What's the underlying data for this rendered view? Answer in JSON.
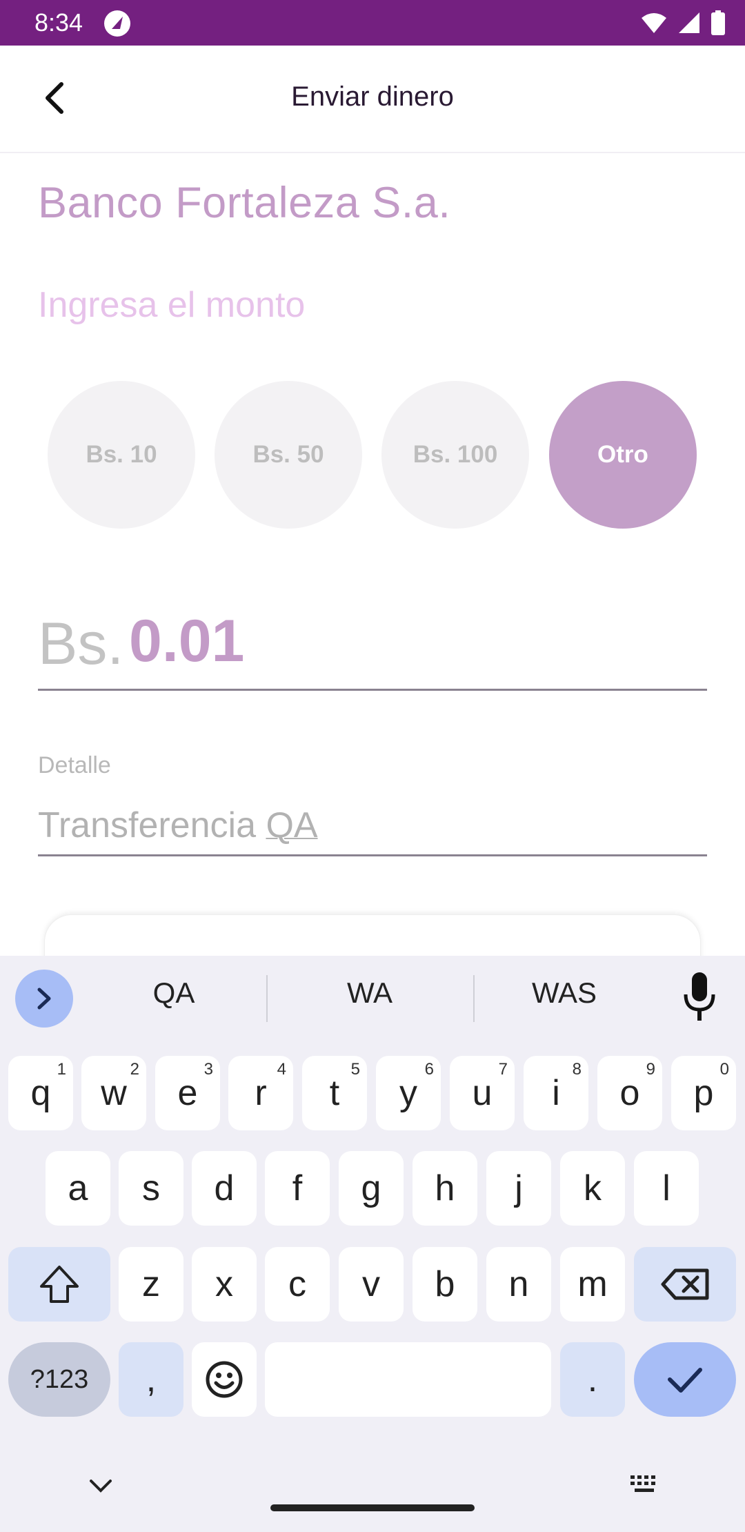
{
  "status_bar": {
    "time": "8:34"
  },
  "app_bar": {
    "title": "Enviar dinero"
  },
  "bank_name": "Banco Fortaleza S.a.",
  "amount_prompt": "Ingresa el monto",
  "amount_chips": [
    {
      "label": "Bs. 10",
      "selected": false
    },
    {
      "label": "Bs. 50",
      "selected": false
    },
    {
      "label": "Bs. 100",
      "selected": false
    },
    {
      "label": "Otro",
      "selected": true
    }
  ],
  "amount": {
    "currency": "Bs.",
    "value": "0.01"
  },
  "detail": {
    "label": "Detalle",
    "value_prefix": "Transferencia ",
    "value_underlined": "QA"
  },
  "keyboard": {
    "suggestions": [
      "QA",
      "WA",
      "WAS"
    ],
    "row1": [
      {
        "k": "q",
        "h": "1"
      },
      {
        "k": "w",
        "h": "2"
      },
      {
        "k": "e",
        "h": "3"
      },
      {
        "k": "r",
        "h": "4"
      },
      {
        "k": "t",
        "h": "5"
      },
      {
        "k": "y",
        "h": "6"
      },
      {
        "k": "u",
        "h": "7"
      },
      {
        "k": "i",
        "h": "8"
      },
      {
        "k": "o",
        "h": "9"
      },
      {
        "k": "p",
        "h": "0"
      }
    ],
    "row2": [
      "a",
      "s",
      "d",
      "f",
      "g",
      "h",
      "j",
      "k",
      "l"
    ],
    "row3": [
      "z",
      "x",
      "c",
      "v",
      "b",
      "n",
      "m"
    ],
    "sym_label": "?123",
    "comma": ",",
    "period": "."
  },
  "colors": {
    "status_bar": "#742080",
    "accent": "#c39bc7",
    "chip_selected": "#c39fc8",
    "keyboard_accent": "#a7bdf6"
  }
}
